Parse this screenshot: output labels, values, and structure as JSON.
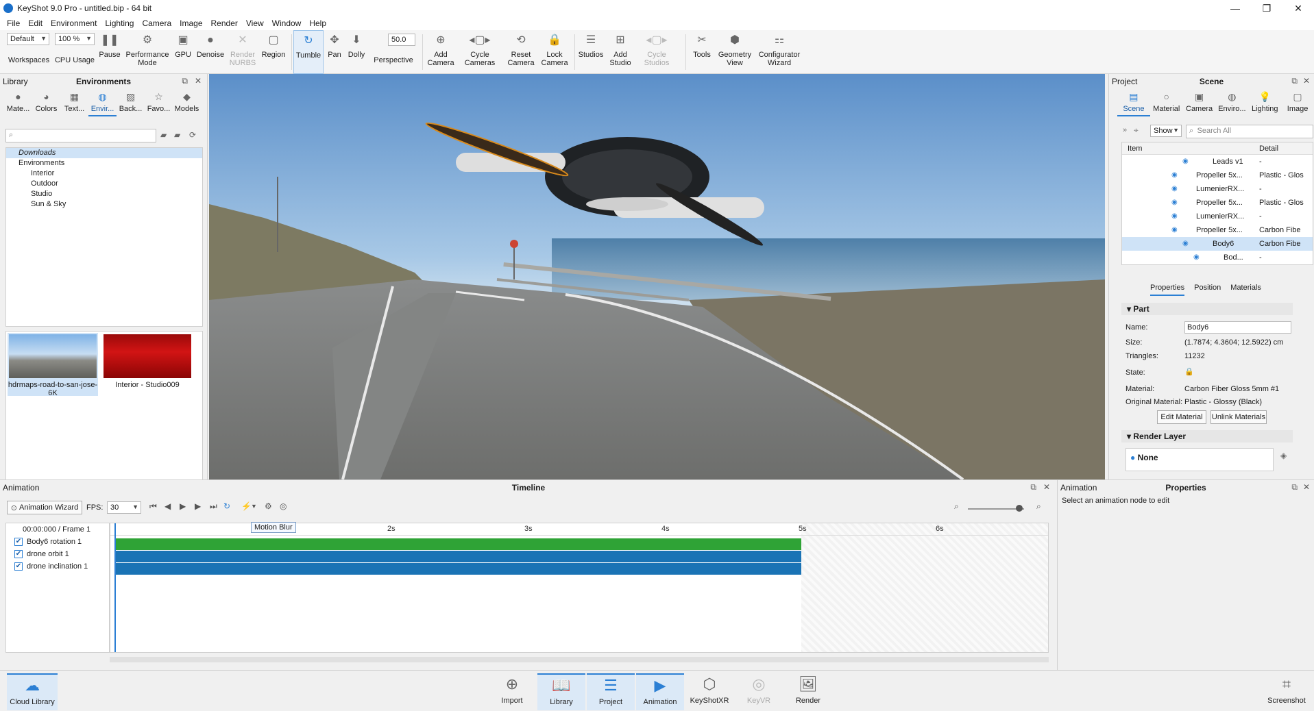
{
  "window": {
    "title": "KeyShot 9.0 Pro  -  untitled.bip  - 64 bit",
    "controls": [
      "—",
      "❐",
      "✕"
    ]
  },
  "menu": [
    "File",
    "Edit",
    "Environment",
    "Lighting",
    "Camera",
    "Image",
    "Render",
    "View",
    "Window",
    "Help"
  ],
  "ribbon": {
    "workspace_value": "Default",
    "zoom_value": "100 %",
    "fov_value": "50.0",
    "buttons": {
      "workspaces": "Workspaces",
      "cpu_usage": "CPU Usage",
      "pause": "Pause",
      "performance_mode": "Performance Mode",
      "gpu": "GPU",
      "denoise": "Denoise",
      "render_nurbs": "Render NURBS",
      "region": "Region",
      "tumble": "Tumble",
      "pan": "Pan",
      "dolly": "Dolly",
      "perspective": "Perspective",
      "add_camera": "Add Camera",
      "cycle_cameras": "Cycle Cameras",
      "reset_camera": "Reset Camera",
      "lock_camera": "Lock Camera",
      "studios": "Studios",
      "add_studio": "Add Studio",
      "cycle_studios": "Cycle Studios",
      "tools": "Tools",
      "geometry_view": "Geometry View",
      "configurator_wizard": "Configurator Wizard"
    }
  },
  "library": {
    "label": "Library",
    "title": "Environments",
    "tabs": [
      "Mate...",
      "Colors",
      "Text...",
      "Envir...",
      "Back...",
      "Favo...",
      "Models"
    ],
    "tree": [
      "Downloads",
      "Environments",
      "Interior",
      "Outdoor",
      "Studio",
      "Sun & Sky"
    ],
    "thumbs": [
      {
        "label": "hdrmaps-road-to-san-jose-6K"
      },
      {
        "label": "Interior - Studio009"
      }
    ]
  },
  "project": {
    "label": "Project",
    "title": "Scene",
    "tabs": [
      "Scene",
      "Material",
      "Camera",
      "Enviro...",
      "Lighting",
      "Image"
    ],
    "show_label": "Show",
    "search_placeholder": "Search All",
    "columns": {
      "item": "Item",
      "detail": "Detail"
    },
    "rows": [
      {
        "item": "Leads v1",
        "detail": "-"
      },
      {
        "item": "Propeller 5x...",
        "detail": "Plastic - Glos"
      },
      {
        "item": "LumenierRX...",
        "detail": "-"
      },
      {
        "item": "Propeller 5x...",
        "detail": "Plastic - Glos"
      },
      {
        "item": "LumenierRX...",
        "detail": "-"
      },
      {
        "item": "Propeller 5x...",
        "detail": "Carbon Fibe"
      },
      {
        "item": "Body6",
        "detail": "Carbon Fibe"
      },
      {
        "item": "Bod...",
        "detail": "-"
      }
    ],
    "subtabs": [
      "Properties",
      "Position",
      "Materials"
    ],
    "part": {
      "heading": "Part",
      "name_label": "Name:",
      "name_value": "Body6",
      "size_label": "Size:",
      "size_value": "(1.7874; 4.3604; 12.5922) cm",
      "triangles_label": "Triangles:",
      "triangles_value": "11232",
      "state_label": "State:",
      "material_label": "Material:",
      "material_value": "Carbon Fiber Gloss 5mm #1",
      "orig_label": "Original Material:",
      "orig_value": "Plastic - Glossy (Black)",
      "edit_btn": "Edit Material",
      "unlink_btn": "Unlink Materials"
    },
    "render_layer": {
      "heading": "Render Layer",
      "value": "None"
    }
  },
  "timeline": {
    "label": "Animation",
    "title": "Timeline",
    "wizard": "Animation Wizard",
    "fps_label": "FPS:",
    "fps_value": "30",
    "time_readout": "00:00:000 / Frame 1",
    "tooltip": "Motion Blur",
    "ruler": [
      "2s",
      "3s",
      "4s",
      "5s",
      "6s"
    ],
    "tracks": [
      {
        "name": "Body6 rotation 1",
        "color": "#2fa336"
      },
      {
        "name": "drone orbit 1",
        "color": "#1a73b5"
      },
      {
        "name": "drone inclination 1",
        "color": "#1a73b5"
      }
    ]
  },
  "anim_props": {
    "label": "Animation",
    "title": "Properties",
    "hint": "Select an animation node to edit"
  },
  "bottombar": {
    "cloud_library": "Cloud Library",
    "import": "Import",
    "library": "Library",
    "project": "Project",
    "animation": "Animation",
    "keyshotxr": "KeyShotXR",
    "keyvr": "KeyVR",
    "render": "Render",
    "screenshot": "Screenshot"
  }
}
